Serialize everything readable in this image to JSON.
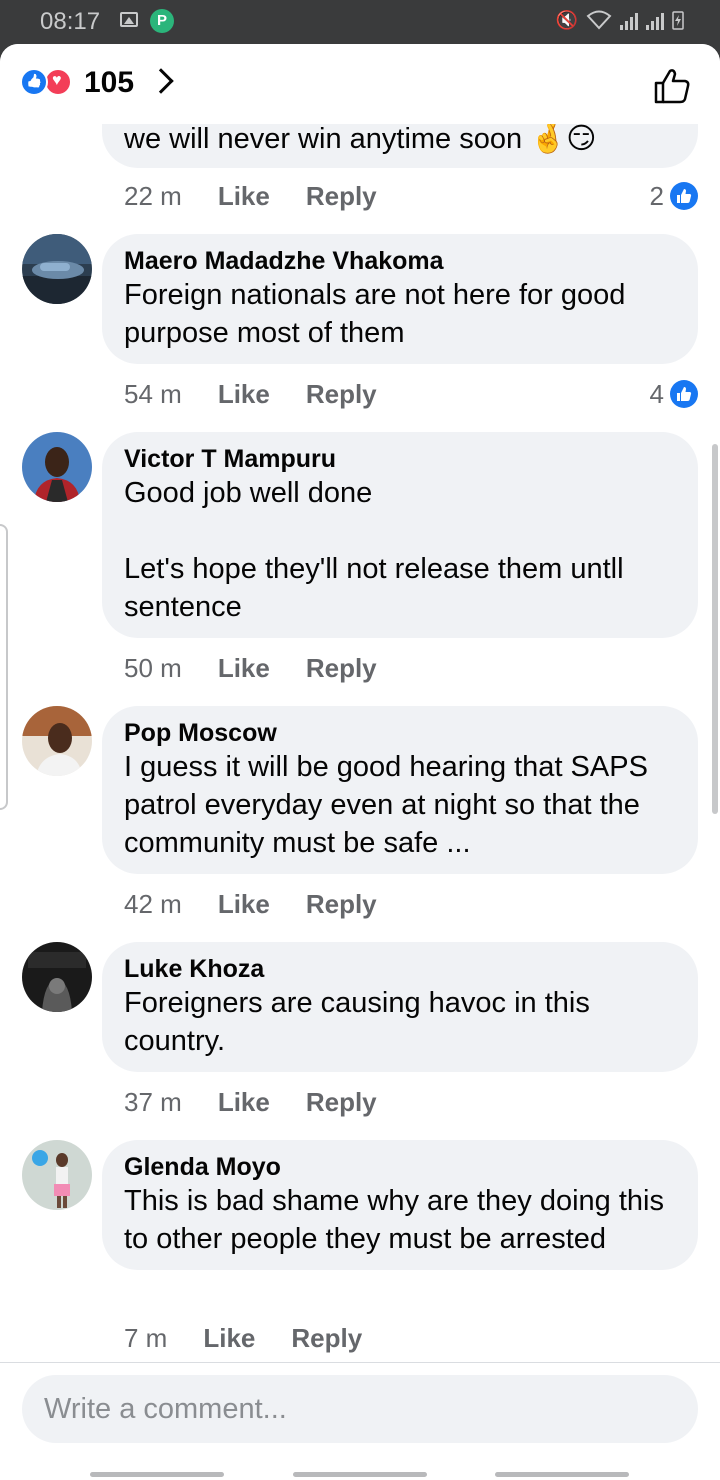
{
  "status_bar": {
    "time": "08:17",
    "icons": [
      "gallery-icon",
      "app-notification-icon",
      "mute-icon",
      "wifi-icon",
      "signal-icon",
      "signal-icon",
      "battery-charging-icon"
    ]
  },
  "header": {
    "reaction_count": "105",
    "icons": [
      "like-reaction-icon",
      "love-reaction-icon",
      "chevron-right-icon",
      "thumbs-up-outline-icon"
    ]
  },
  "comments": [
    {
      "author": "",
      "text": "we will never win anytime soon 🤞😏",
      "time": "22 m",
      "like_label": "Like",
      "reply_label": "Reply",
      "likes": "2"
    },
    {
      "author": "Maero Madadzhe Vhakoma",
      "text": "Foreign nationals are not here for good purpose most of them",
      "time": "54 m",
      "like_label": "Like",
      "reply_label": "Reply",
      "likes": "4"
    },
    {
      "author": "Victor T Mampuru",
      "text": "Good job well done\n\nLet's hope they'll not release them untll sentence",
      "time": "50 m",
      "like_label": "Like",
      "reply_label": "Reply",
      "likes": ""
    },
    {
      "author": "Pop Moscow",
      "text": "I guess it will be good hearing that SAPS patrol everyday even at night so that the community must be safe ...",
      "time": "42 m",
      "like_label": "Like",
      "reply_label": "Reply",
      "likes": ""
    },
    {
      "author": "Luke Khoza",
      "text": "Foreigners are causing havoc in this country.",
      "time": "37 m",
      "like_label": "Like",
      "reply_label": "Reply",
      "likes": ""
    },
    {
      "author": "Glenda Moyo",
      "text": "This is bad shame why are they doing this to other people they must be arrested",
      "time": "7 m",
      "like_label": "Like",
      "reply_label": "Reply",
      "likes": ""
    }
  ],
  "composer": {
    "placeholder": "Write a comment..."
  },
  "colors": {
    "accent": "#1877f2",
    "love": "#f33e58",
    "bubble": "#f0f2f5",
    "meta_text": "#65676b"
  }
}
